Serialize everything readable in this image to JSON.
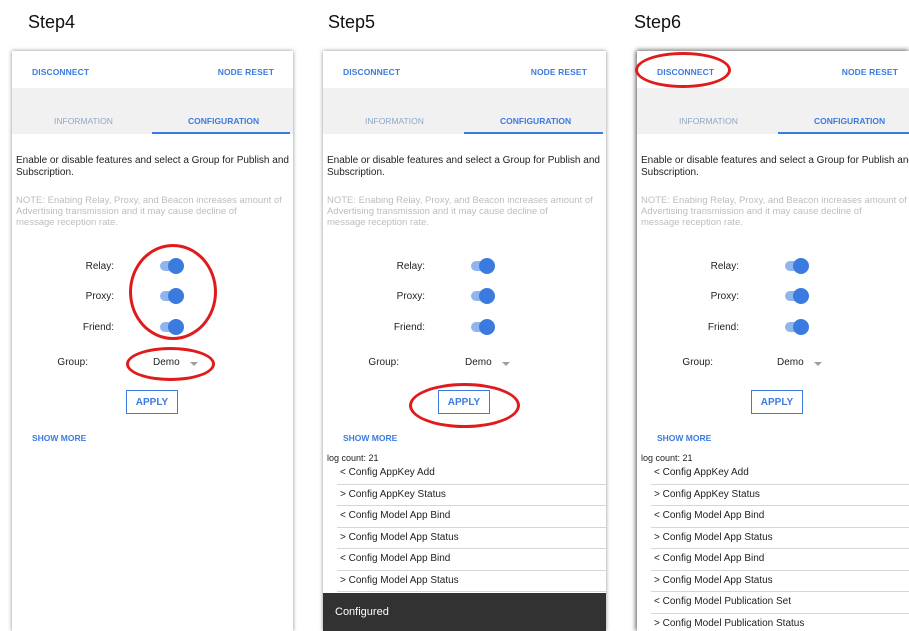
{
  "steps": [
    {
      "title": "Step4"
    },
    {
      "title": "Step5"
    },
    {
      "title": "Step6"
    }
  ],
  "app": {
    "disconnect_label": "DISCONNECT",
    "node_reset_label": "NODE RESET",
    "tabs": {
      "information": "INFORMATION",
      "configuration": "CONFIGURATION"
    },
    "description": [
      "Enable or disable features and select a Group for Publish and",
      "Subscription."
    ],
    "note": [
      "NOTE: Enabing Relay, Proxy, and Beacon increases amount of",
      "Advertising transmission and it may cause decline of",
      "message reception rate."
    ],
    "relay_label": "Relay:",
    "proxy_label": "Proxy:",
    "friend_label": "Friend:",
    "group_label": "Group:",
    "group_value": "Demo",
    "relay_on": true,
    "proxy_on": true,
    "friend_on": true,
    "apply_label": "APPLY",
    "show_more_label": "SHOW MORE",
    "log_count": "log count: 21",
    "logs_step5": [
      "< Config AppKey Add",
      "> Config AppKey Status",
      "< Config Model App Bind",
      "> Config Model App Status",
      "< Config Model App Bind",
      "> Config Model App Status"
    ],
    "logs_step6": [
      "< Config AppKey Add",
      "> Config AppKey Status",
      "< Config Model App Bind",
      "> Config Model App Status",
      "< Config Model App Bind",
      "> Config Model App Status",
      "< Config Model Publication Set",
      "> Config Model Publication Status"
    ],
    "snackbar": "Configured"
  },
  "colors": {
    "accent": "#3b7be0",
    "highlight": "#e01b1b",
    "snackbar": "#323232"
  }
}
